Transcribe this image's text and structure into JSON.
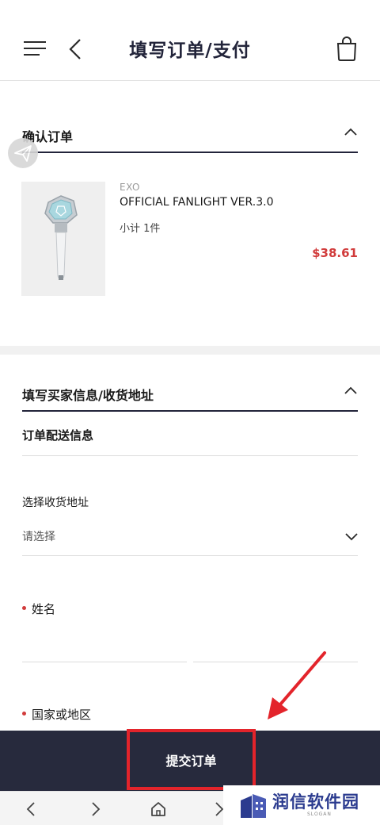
{
  "header": {
    "title": "填写订单/支付",
    "menu_icon": "hamburger-menu-icon",
    "back_icon": "chevron-left-icon",
    "cart_icon": "shopping-bag-icon"
  },
  "confirm_order": {
    "title": "确认订单",
    "toggle_icon": "chevron-up-icon",
    "item": {
      "brand": "EXO",
      "name": "OFFICIAL FANLIGHT VER.3.0",
      "subtotal": "小计 1件",
      "price": "$38.61"
    }
  },
  "buyer_info": {
    "title": "填写买家信息/收货地址",
    "toggle_icon": "chevron-up-icon",
    "delivery_title": "订单配送信息",
    "address_label": "选择收货地址",
    "address_value": "请选择",
    "name_label": "姓名",
    "country_label": "国家或地区"
  },
  "submit": {
    "label": "提交订单"
  },
  "browser_nav": {
    "icons": [
      "chevron-left-icon",
      "chevron-right-icon",
      "home-icon",
      "chevron-right-icon"
    ]
  },
  "watermark": {
    "text": "润信软件园",
    "slogan": "SLOGAN"
  },
  "colors": {
    "accent_dark": "#272a3d",
    "price_red": "#d13b3b",
    "highlight_red": "#e3242b",
    "watermark_blue": "#2b3b8f"
  }
}
